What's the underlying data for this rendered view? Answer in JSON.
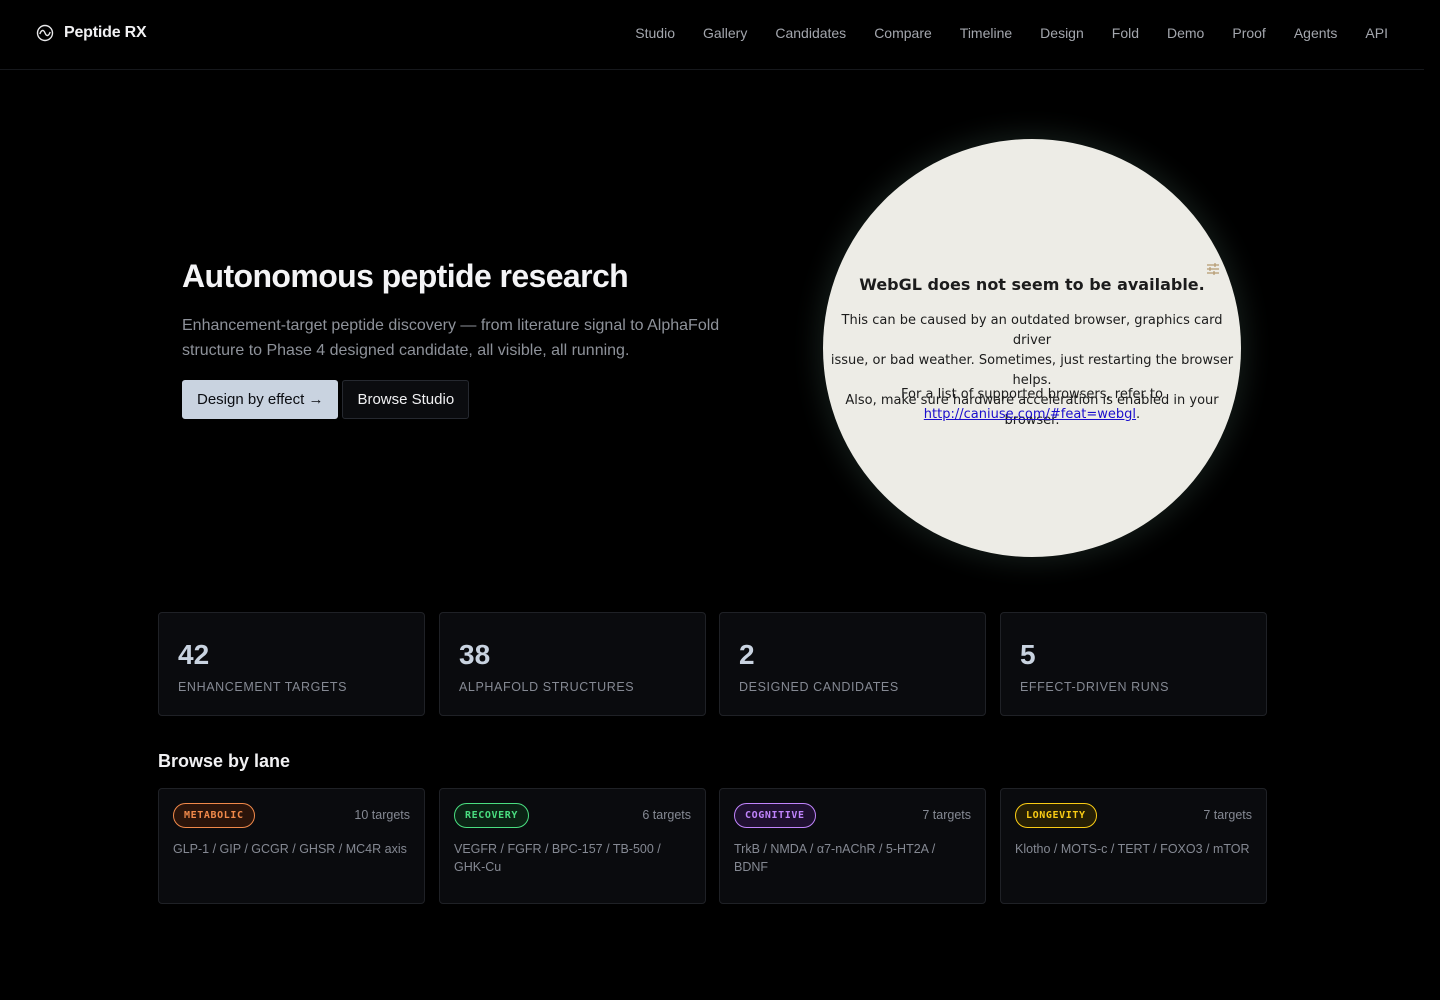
{
  "header": {
    "brand": "Peptide RX",
    "nav": [
      "Studio",
      "Gallery",
      "Candidates",
      "Compare",
      "Timeline",
      "Design",
      "Fold",
      "Demo",
      "Proof",
      "Agents",
      "API"
    ]
  },
  "hero": {
    "title": "Autonomous peptide research",
    "subtitle": "Enhancement-target peptide discovery — from literature signal to AlphaFold structure to Phase 4 designed candidate, all visible, all running.",
    "primary_button": "Design by effect →",
    "secondary_button": "Browse Studio"
  },
  "webgl": {
    "title": "WebGL does not seem to be available.",
    "description_lines": [
      "This can be caused by an outdated browser, graphics card driver",
      "issue, or bad weather. Sometimes, just restarting the browser helps.",
      "Also, make sure hardware acceleration is enabled in your browser."
    ],
    "ref_text": "For a list of supported browsers, refer to",
    "link": "http://caniuse.com/#feat=webgl",
    "link_suffix": "."
  },
  "stats": [
    {
      "value": "42",
      "label": "ENHANCEMENT TARGETS"
    },
    {
      "value": "38",
      "label": "ALPHAFOLD STRUCTURES"
    },
    {
      "value": "2",
      "label": "DESIGNED CANDIDATES"
    },
    {
      "value": "5",
      "label": "EFFECT-DRIVEN RUNS"
    }
  ],
  "lanes_title": "Browse by lane",
  "lanes": [
    {
      "badge": "METABOLIC",
      "count": "10 targets",
      "targets": "GLP-1 / GIP / GCGR / GHSR / MC4R axis",
      "color": "#f0894a",
      "bg": "#2a140a"
    },
    {
      "badge": "RECOVERY",
      "count": "6 targets",
      "targets": "VEGFR / FGFR / BPC-157 / TB-500 / GHK-Cu",
      "color": "#4ade80",
      "bg": "#0b2214"
    },
    {
      "badge": "COGNITIVE",
      "count": "7 targets",
      "targets": "TrkB / NMDA / α7-nAChR / 5-HT2A / BDNF",
      "color": "#c084fc",
      "bg": "#1f1030"
    },
    {
      "badge": "LONGEVITY",
      "count": "7 targets",
      "targets": "Klotho / MOTS-c / TERT / FOXO3 / mTOR",
      "color": "#facc15",
      "bg": "#261f05"
    }
  ]
}
